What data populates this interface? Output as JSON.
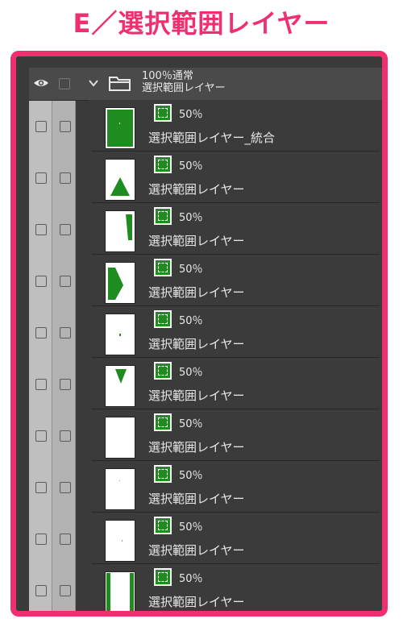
{
  "heading": "E／選択範囲レイヤー",
  "folder": {
    "blend": "100％通常",
    "name": "選択範囲レイヤー"
  },
  "layers": [
    {
      "opacity": "50％",
      "name": "選択範囲レイヤー_統合",
      "thumb": "full"
    },
    {
      "opacity": "50％",
      "name": "選択範囲レイヤー",
      "thumb": "triangle-up"
    },
    {
      "opacity": "50％",
      "name": "選択範囲レイヤー",
      "thumb": "right-sliver"
    },
    {
      "opacity": "50％",
      "name": "選択範囲レイヤー",
      "thumb": "left-wedge"
    },
    {
      "opacity": "50％",
      "name": "選択範囲レイヤー",
      "thumb": "dot"
    },
    {
      "opacity": "50％",
      "name": "選択範囲レイヤー",
      "thumb": "triangle-down"
    },
    {
      "opacity": "50％",
      "name": "選択範囲レイヤー",
      "thumb": "empty"
    },
    {
      "opacity": "50％",
      "name": "選択範囲レイヤー",
      "thumb": "tiny"
    },
    {
      "opacity": "50％",
      "name": "選択範囲レイヤー",
      "thumb": "tiny2"
    },
    {
      "opacity": "50％",
      "name": "選択範囲レイヤー",
      "thumb": "frame"
    }
  ],
  "colors": {
    "accent": "#f0306e",
    "mask_green": "#1e8c1e"
  },
  "icons": {
    "visibility": "eye-icon",
    "folder": "folder-icon",
    "expand": "chevron-down-icon",
    "mask": "selection-mask-icon"
  }
}
